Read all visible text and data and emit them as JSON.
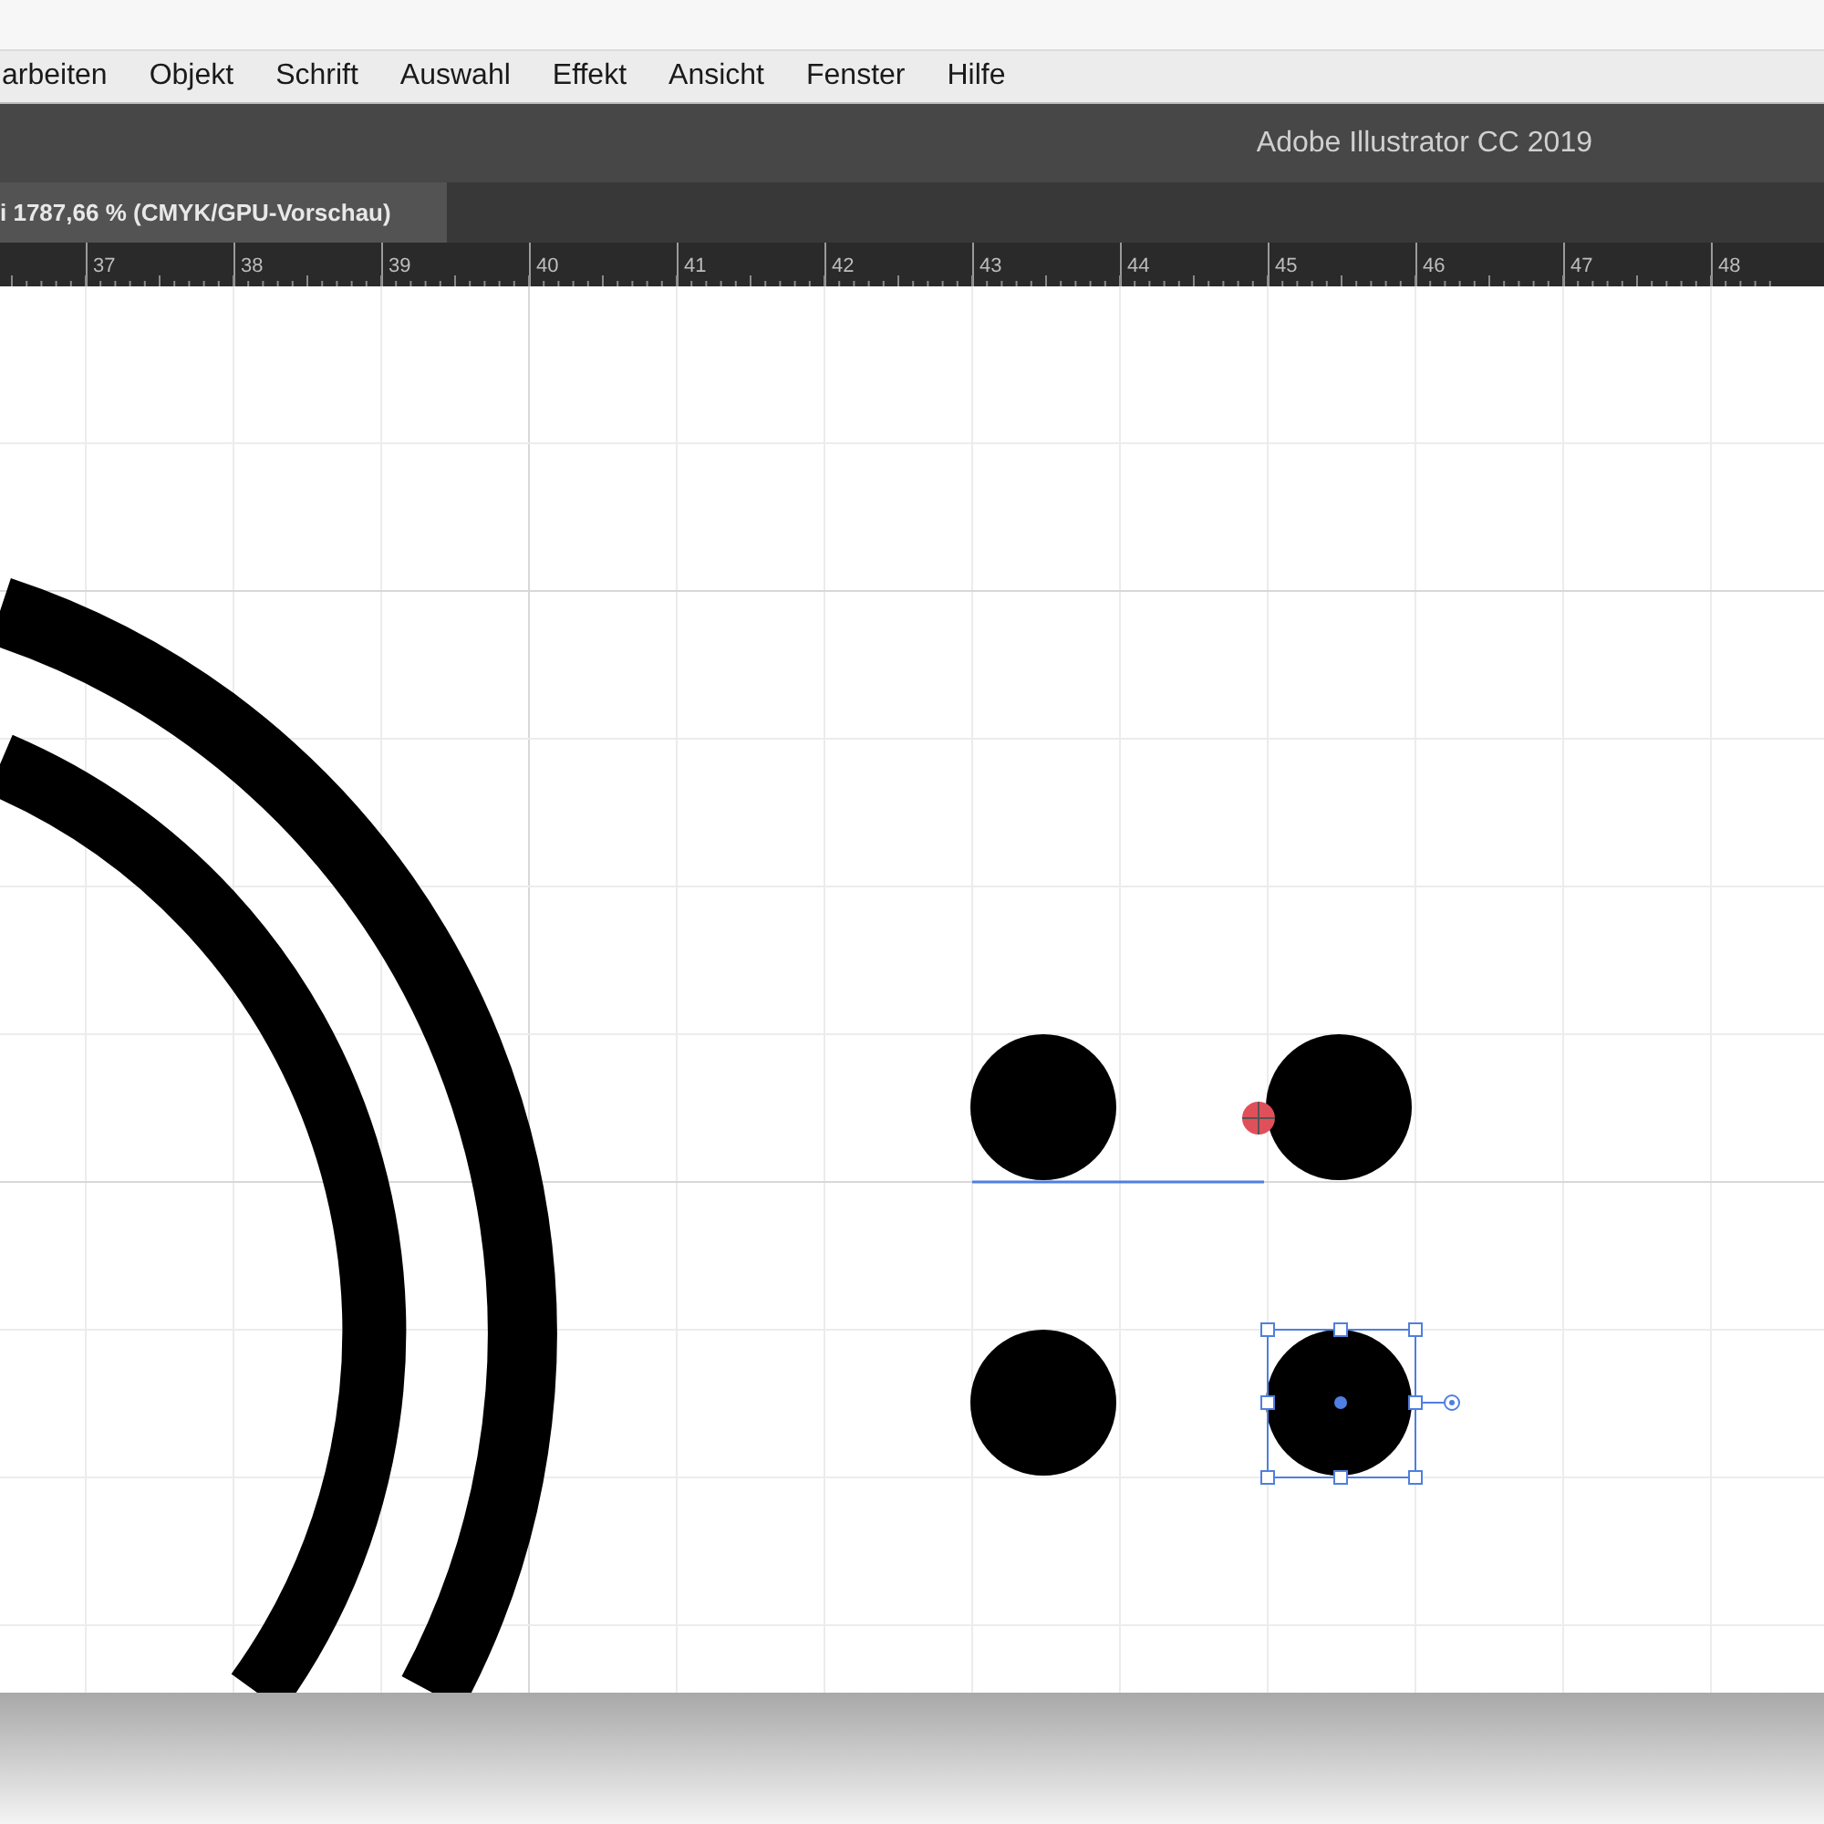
{
  "menu_bar": [
    "arbeiten",
    "Objekt",
    "Schrift",
    "Auswahl",
    "Effekt",
    "Ansicht",
    "Fenster",
    "Hilfe"
  ],
  "window": {
    "title": "Adobe Illustrator CC 2019"
  },
  "tabs": [
    {
      "label": "i 1787,66 % (CMYK/GPU-Vorschau)",
      "selected": true
    }
  ],
  "ruler": [
    "37",
    "38",
    "39",
    "40",
    "41",
    "42",
    "43",
    "44",
    "45",
    "46",
    "47",
    "48"
  ]
}
